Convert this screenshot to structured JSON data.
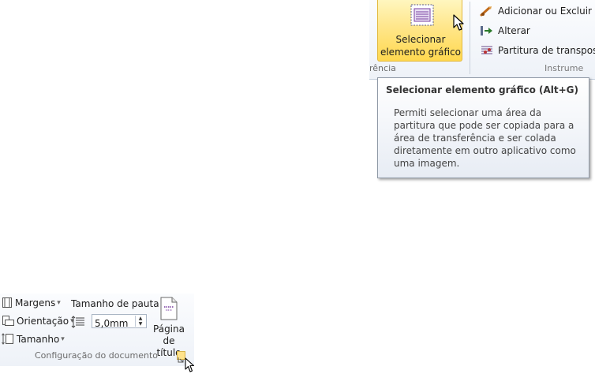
{
  "ribbon_top": {
    "select_button_label_line1": "Selecionar",
    "select_button_label_line2": "elemento gráfico",
    "left_group_label": "rência",
    "commands": {
      "add_remove": "Adicionar ou Excluir",
      "change": "Alterar",
      "transposing_score": "Partitura de transpos"
    },
    "right_group_label": "Instrume"
  },
  "tooltip": {
    "title": "Selecionar elemento gráfico (Alt+G)",
    "body": "Permiti selecionar uma área da partitura que pode ser copiada para a área de transferência e ser colada diretamente em outro aplicativo como uma imagem."
  },
  "ribbon_bottom": {
    "margins": "Margens",
    "orientation": "Orientação",
    "size": "Tamanho",
    "staff_size_label": "Tamanho de pauta",
    "staff_size_value": "5,0mm",
    "title_page_line1": "Página",
    "title_page_line2": "de título",
    "group_label": "Configuração do documento"
  },
  "colors": {
    "highlight": "#ffd84f",
    "ribbon_bg": "#eef2f8",
    "tooltip_border": "#8f99a6"
  }
}
